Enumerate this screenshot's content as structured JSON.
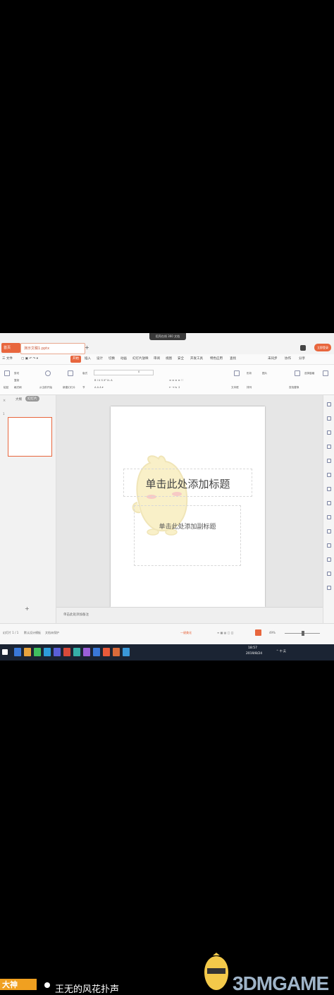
{
  "colors": {
    "accent": "#e8663d",
    "taskbar": "#1b2433",
    "green_edge": "#1fbf5a"
  },
  "window": {
    "screen_title": "稻壳在线 360 文档",
    "login_label": "立即登录",
    "tabs": [
      {
        "label": "首页",
        "name": "tab-home"
      },
      {
        "label": "演示文稿1.pptx",
        "name": "tab-doc"
      },
      {
        "label": "+",
        "name": "tab-plus"
      }
    ]
  },
  "menu": {
    "file": "三 文件",
    "items": [
      "开始",
      "插入",
      "设计",
      "切换",
      "动画",
      "幻灯片放映",
      "审阅",
      "视图",
      "安全",
      "开发工具",
      "特色应用",
      "查找"
    ],
    "active": "开始",
    "right": [
      "未同步",
      "协作",
      "分享"
    ]
  },
  "ribbon": {
    "paste": "粘贴",
    "cut": "剪切",
    "copy": "复制",
    "format_painter": "格式刷",
    "from_current": "从当前开始",
    "new_slide": "新建幻灯片",
    "layout": "版式",
    "reset": "重置",
    "section": "节",
    "font_size": "0",
    "text_box": "文本框",
    "shape": "形状",
    "arrange": "排列",
    "picture": "图片",
    "find_replace": "查找替换",
    "select": "选择窗格"
  },
  "left_panel": {
    "close": "×",
    "tab_outline": "大纲",
    "tab_slides": "幻灯片",
    "thumb_number": "1",
    "add_slide": "+"
  },
  "slide": {
    "title_placeholder": "单击此处添加标题",
    "subtitle_placeholder": "单击此处添加副标题"
  },
  "notes": {
    "placeholder": "单击此处添加备注"
  },
  "statusbar": {
    "slide_count": "幻灯片 1 / 1",
    "theme": "默认设计模板",
    "file_repair": "文档未保护",
    "beautify": "一键美化",
    "zoom": "49%"
  },
  "taskbar": {
    "time": "18:57",
    "date": "2019/8/24",
    "tray": "^ 中 英"
  },
  "overlay": {
    "tag": "大神",
    "caption": "王无的风花扑声",
    "watermark": "3DMGAME"
  }
}
